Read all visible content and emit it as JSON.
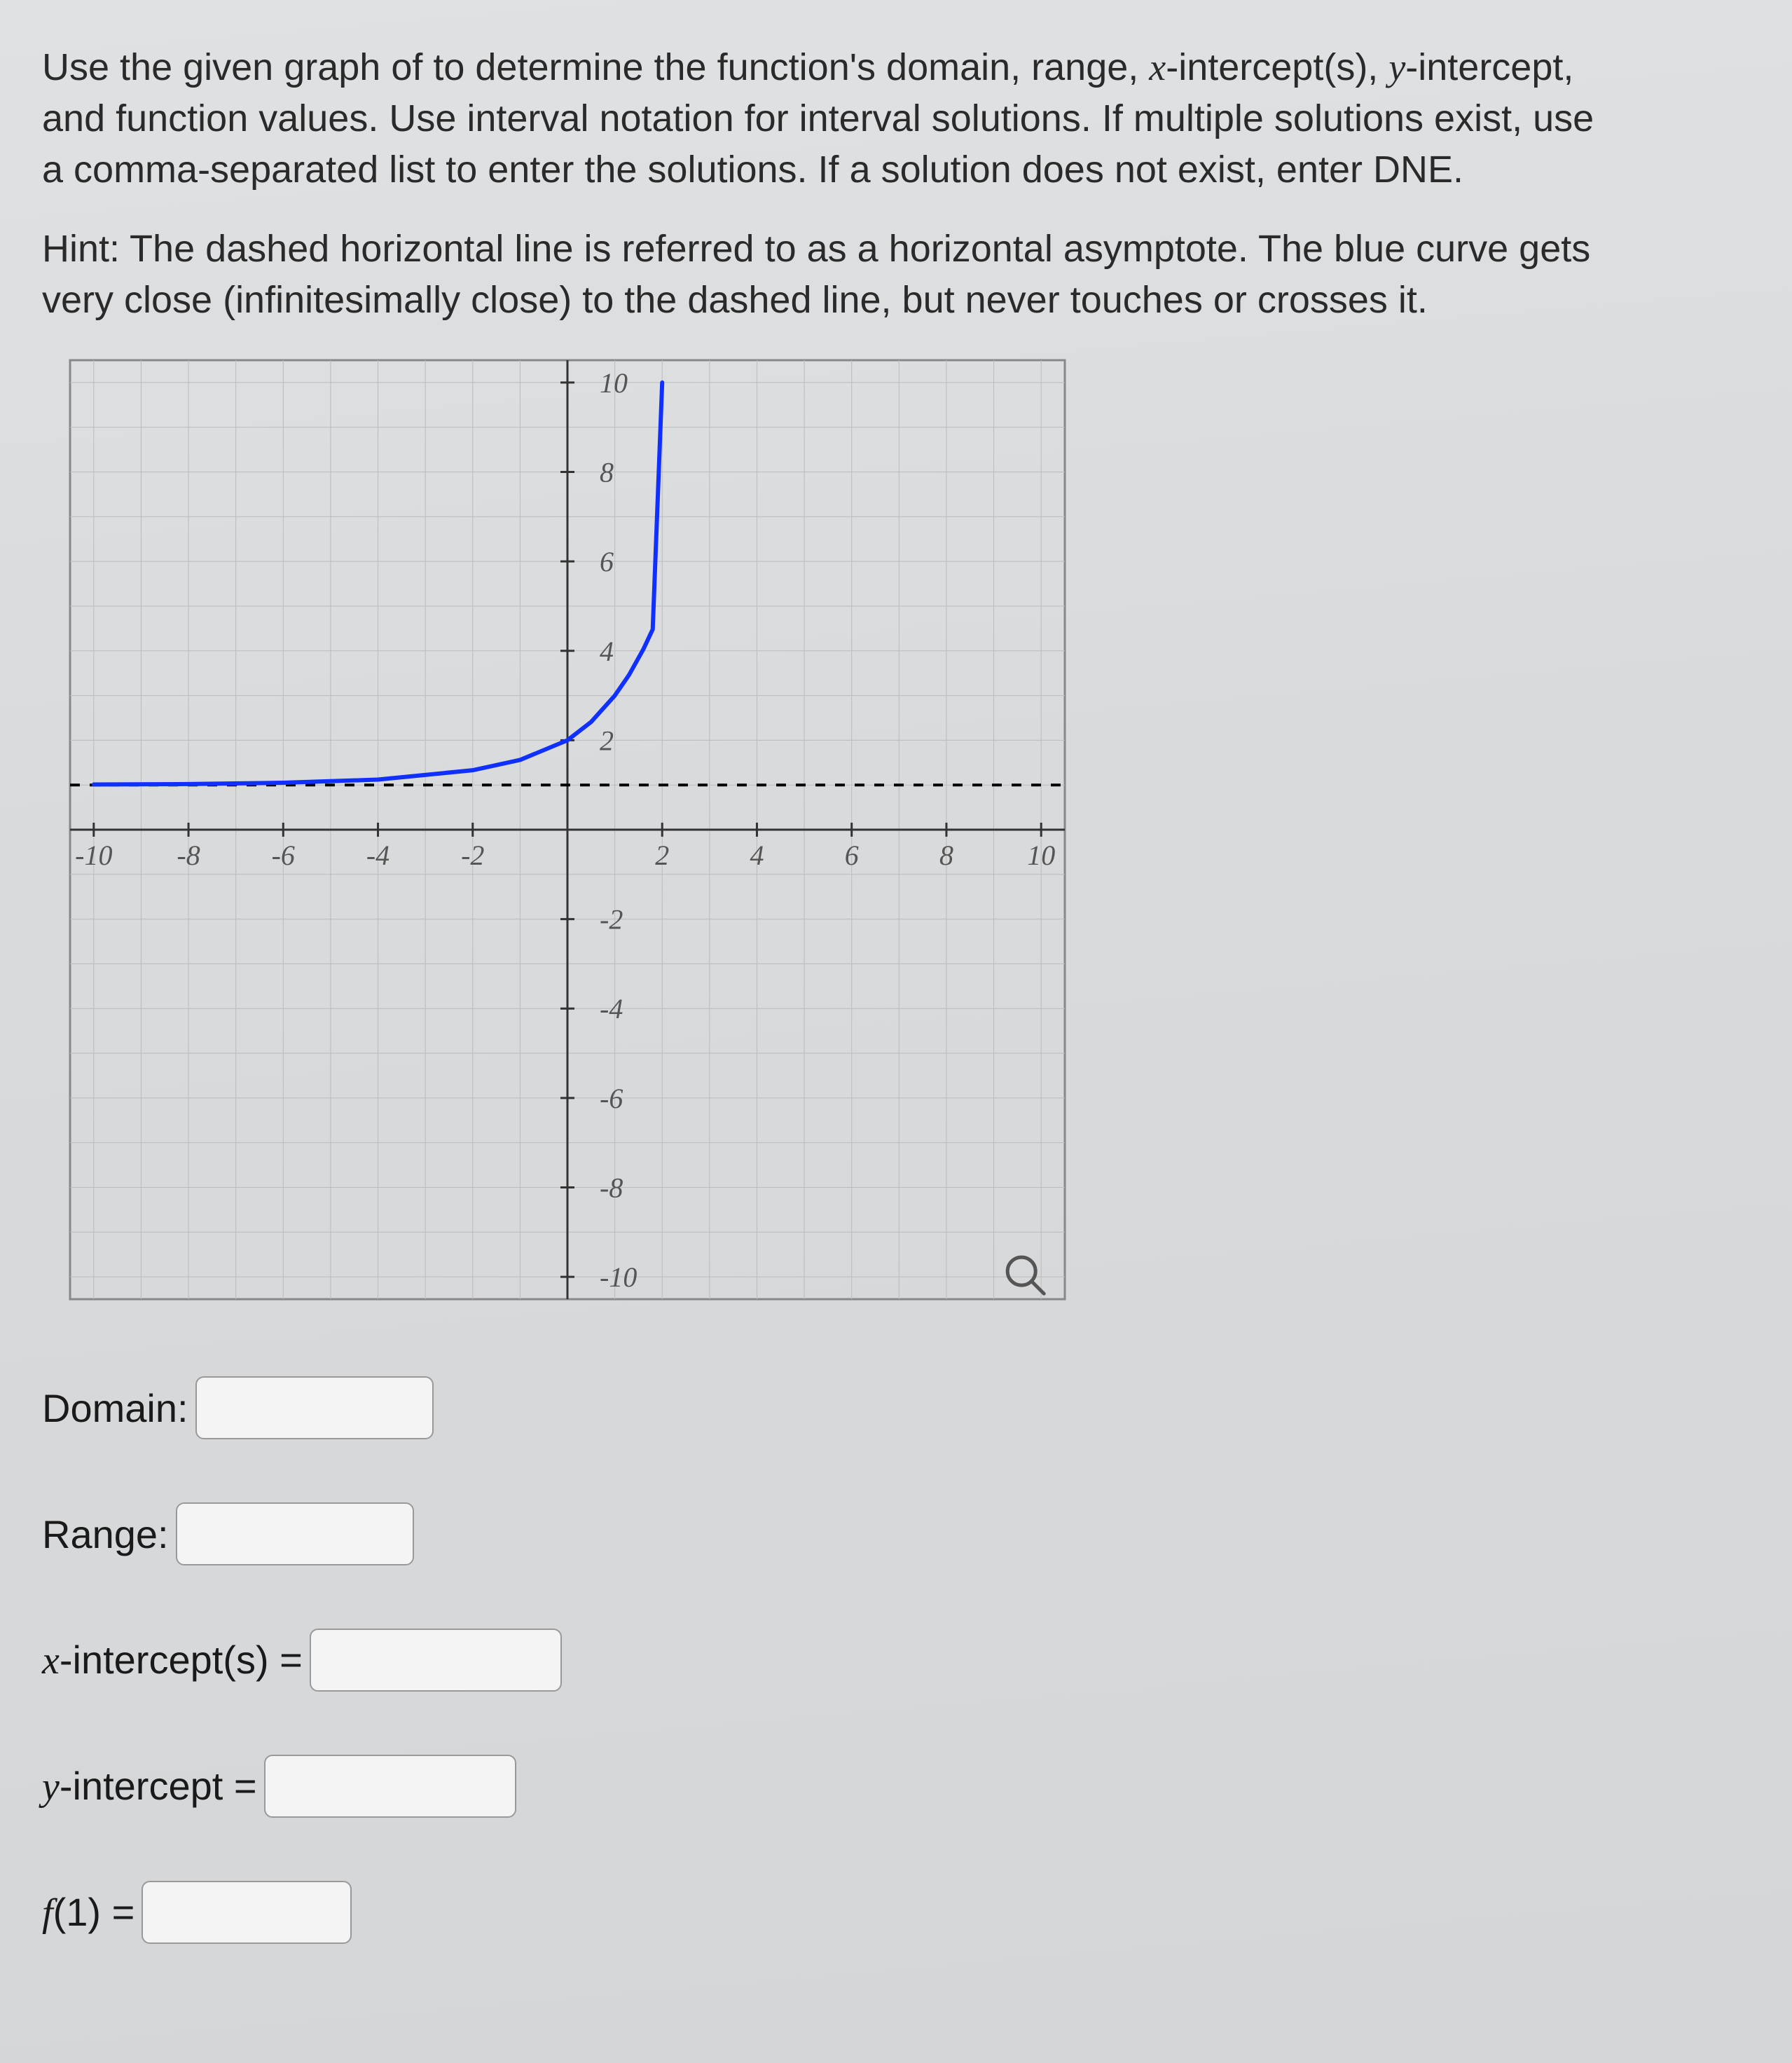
{
  "problem": {
    "line1_pre": "Use the given graph of to determine the function's domain, range, ",
    "xint": "x",
    "line1_mid": "-intercept(s), ",
    "yint": "y",
    "line1_post": "-intercept,",
    "line2": "and function values. Use interval notation for interval solutions. If multiple solutions exist, use",
    "line3": "a comma-separated list to enter the solutions. If a solution does not exist, enter DNE."
  },
  "hint": {
    "line1": "Hint: The dashed horizontal line is referred to as a horizontal asymptote. The blue curve gets",
    "line2": "very close (infinitesimally close) to the dashed line, but never touches or crosses it."
  },
  "chart_data": {
    "type": "line",
    "title": "",
    "xlabel": "",
    "ylabel": "",
    "xlim": [
      -10.5,
      10.5
    ],
    "ylim": [
      -10.5,
      10.5
    ],
    "x_ticks": [
      -10,
      -8,
      -6,
      -4,
      -2,
      2,
      4,
      6,
      8,
      10
    ],
    "y_ticks": [
      -10,
      -8,
      -6,
      -4,
      -2,
      2,
      4,
      6,
      8,
      10
    ],
    "asymptote_y": 1,
    "series": [
      {
        "name": "f",
        "x": [
          -10,
          -8,
          -6,
          -4,
          -2,
          -1,
          0,
          0.5,
          1,
          1.3,
          1.6,
          1.8,
          2
        ],
        "values": [
          1.01,
          1.02,
          1.05,
          1.12,
          1.33,
          1.56,
          2,
          2.41,
          3,
          3.46,
          4.03,
          4.48,
          10
        ]
      }
    ],
    "x_domain": [
      -10,
      2
    ]
  },
  "answers": {
    "domain_label": "Domain:",
    "range_label": "Range:",
    "xint_prefix": "x",
    "int_suffix": "-intercept(s) =",
    "yint_prefix": "y",
    "yint_suffix": "-intercept =",
    "f1_label": "f(1) =",
    "f1_prefix": "f",
    "f1_arg": "(1) ="
  }
}
